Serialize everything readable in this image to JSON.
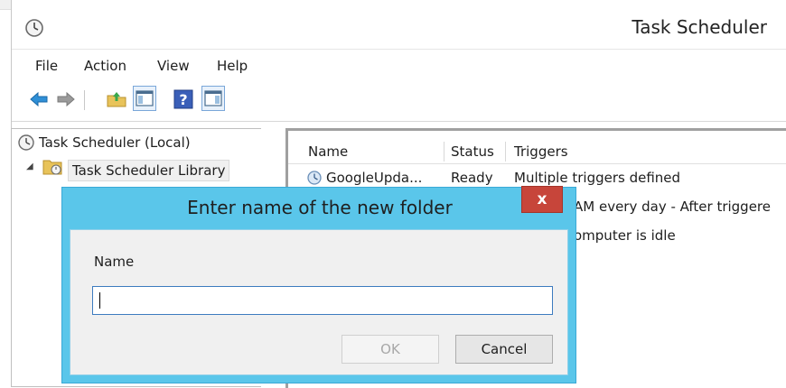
{
  "window": {
    "title": "Task Scheduler",
    "menu": [
      "File",
      "Action",
      "View",
      "Help"
    ]
  },
  "toolbar": {
    "icons": [
      "back-arrow-icon",
      "forward-arrow-icon",
      "folder-up-icon",
      "show-hide-console-tree-icon",
      "help-icon",
      "show-hide-action-pane-icon"
    ]
  },
  "tree": {
    "root": "Task Scheduler (Local)",
    "library": "Task Scheduler Library"
  },
  "task_list": {
    "columns": [
      "Name",
      "Status",
      "Triggers"
    ],
    "rows": [
      {
        "name": "GoogleUpda...",
        "status": "Ready",
        "triggers": "Multiple triggers defined"
      },
      {
        "name": "",
        "status": "",
        "triggers": "AM every day - After triggere"
      },
      {
        "name": "",
        "status": "",
        "triggers": "omputer is idle"
      }
    ]
  },
  "dialog": {
    "title": "Enter name of the new folder",
    "close_label": "x",
    "field_label": "Name",
    "input_value": "",
    "ok_label": "OK",
    "cancel_label": "Cancel"
  },
  "colors": {
    "dialog_frame": "#5ac6ea",
    "close_button": "#c7453a",
    "input_border": "#3d7bbf"
  }
}
